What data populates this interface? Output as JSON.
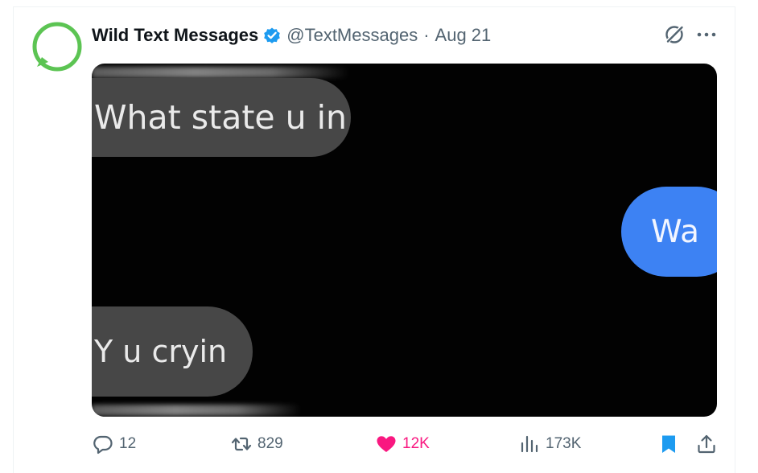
{
  "author": {
    "display_name": "Wild Text Messages",
    "handle": "@TextMessages",
    "separator": "·",
    "date": "Aug 21",
    "verified": true,
    "avatar_icon": "green-message-bubble-ring"
  },
  "header_icons": {
    "grok": "grok-icon",
    "more": "more-icon"
  },
  "media": {
    "messages": [
      {
        "side": "received",
        "text": "What state u in"
      },
      {
        "side": "sent",
        "text": "Wa"
      },
      {
        "side": "received",
        "text": "Y u cryin"
      }
    ]
  },
  "actions": {
    "reply": {
      "icon": "reply-icon",
      "count": "12"
    },
    "retweet": {
      "icon": "retweet-icon",
      "count": "829"
    },
    "like": {
      "icon": "heart-icon",
      "count": "12K",
      "liked": true
    },
    "views": {
      "icon": "views-icon",
      "count": "173K"
    },
    "bookmark": {
      "icon": "bookmark-icon",
      "bookmarked": true
    },
    "share": {
      "icon": "share-icon"
    }
  },
  "colors": {
    "accent": "#1d9bf0",
    "like": "#f91880",
    "muted": "#536471",
    "avatar_green": "#5cc453",
    "sent_bubble": "#3d82f3",
    "received_bubble": "#474747"
  }
}
